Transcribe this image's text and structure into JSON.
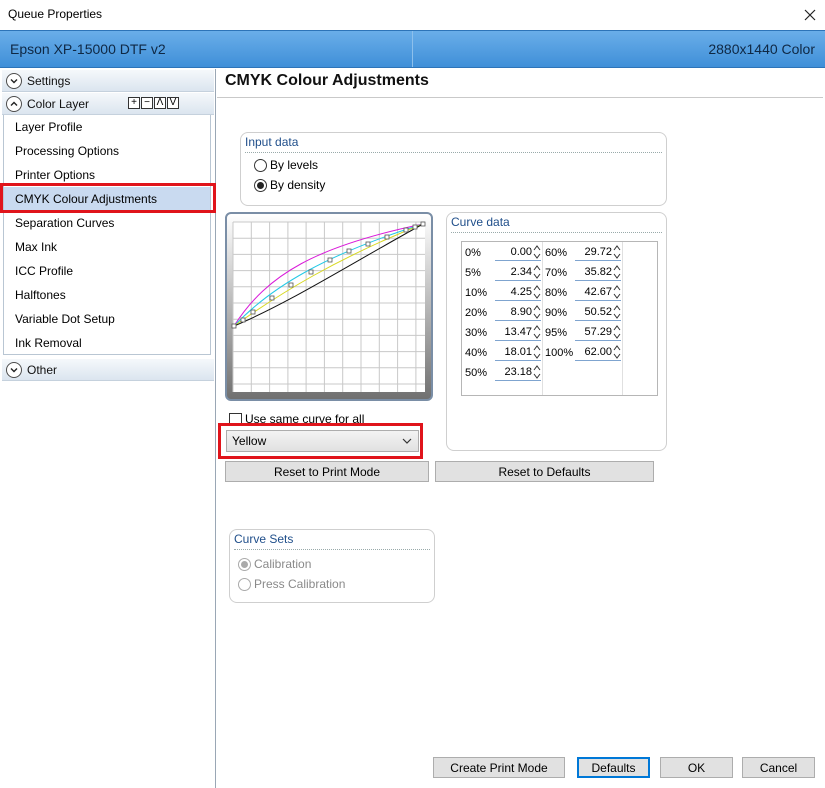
{
  "window": {
    "title": "Queue Properties"
  },
  "header": {
    "printer_name": "Epson XP-15000 DTF v2",
    "resolution": "2880x1440 Color"
  },
  "sidebar": {
    "settings_label": "Settings",
    "color_layer_label": "Color Layer",
    "tools": [
      "+",
      "−",
      "Λ",
      "V"
    ],
    "items": [
      {
        "label": "Layer Profile"
      },
      {
        "label": "Processing Options"
      },
      {
        "label": "Printer Options"
      },
      {
        "label": "CMYK Colour Adjustments",
        "selected": true
      },
      {
        "label": "Separation Curves"
      },
      {
        "label": "Max Ink"
      },
      {
        "label": "ICC Profile"
      },
      {
        "label": "Halftones"
      },
      {
        "label": "Variable Dot Setup"
      },
      {
        "label": "Ink Removal"
      }
    ],
    "other_label": "Other"
  },
  "content": {
    "title": "CMYK Colour Adjustments",
    "input_data": {
      "title": "Input data",
      "by_levels": "By levels",
      "by_density": "By density",
      "selected": "By density"
    },
    "curve_data": {
      "title": "Curve data",
      "left": [
        {
          "pct": "0%",
          "value": "0.00"
        },
        {
          "pct": "5%",
          "value": "2.34"
        },
        {
          "pct": "10%",
          "value": "4.25"
        },
        {
          "pct": "20%",
          "value": "8.90"
        },
        {
          "pct": "30%",
          "value": "13.47"
        },
        {
          "pct": "40%",
          "value": "18.01"
        },
        {
          "pct": "50%",
          "value": "23.18"
        }
      ],
      "right": [
        {
          "pct": "60%",
          "value": "29.72"
        },
        {
          "pct": "70%",
          "value": "35.82"
        },
        {
          "pct": "80%",
          "value": "42.67"
        },
        {
          "pct": "90%",
          "value": "50.52"
        },
        {
          "pct": "95%",
          "value": "57.29"
        },
        {
          "pct": "100%",
          "value": "62.00"
        }
      ]
    },
    "same_curve_label": "Use same curve for all",
    "color_select": {
      "value": "Yellow"
    },
    "reset_print_mode": "Reset to Print Mode",
    "reset_defaults": "Reset to Defaults",
    "curve_sets": {
      "title": "Curve Sets",
      "calibration": "Calibration",
      "press_calibration": "Press Calibration"
    }
  },
  "footer": {
    "create_print_mode": "Create Print Mode",
    "defaults": "Defaults",
    "ok": "OK",
    "cancel": "Cancel"
  },
  "colors": {
    "header": "#3f8fd8",
    "selected": "#c9daf0",
    "highlight": "#e0141b",
    "group_title": "#1f4e8a"
  }
}
